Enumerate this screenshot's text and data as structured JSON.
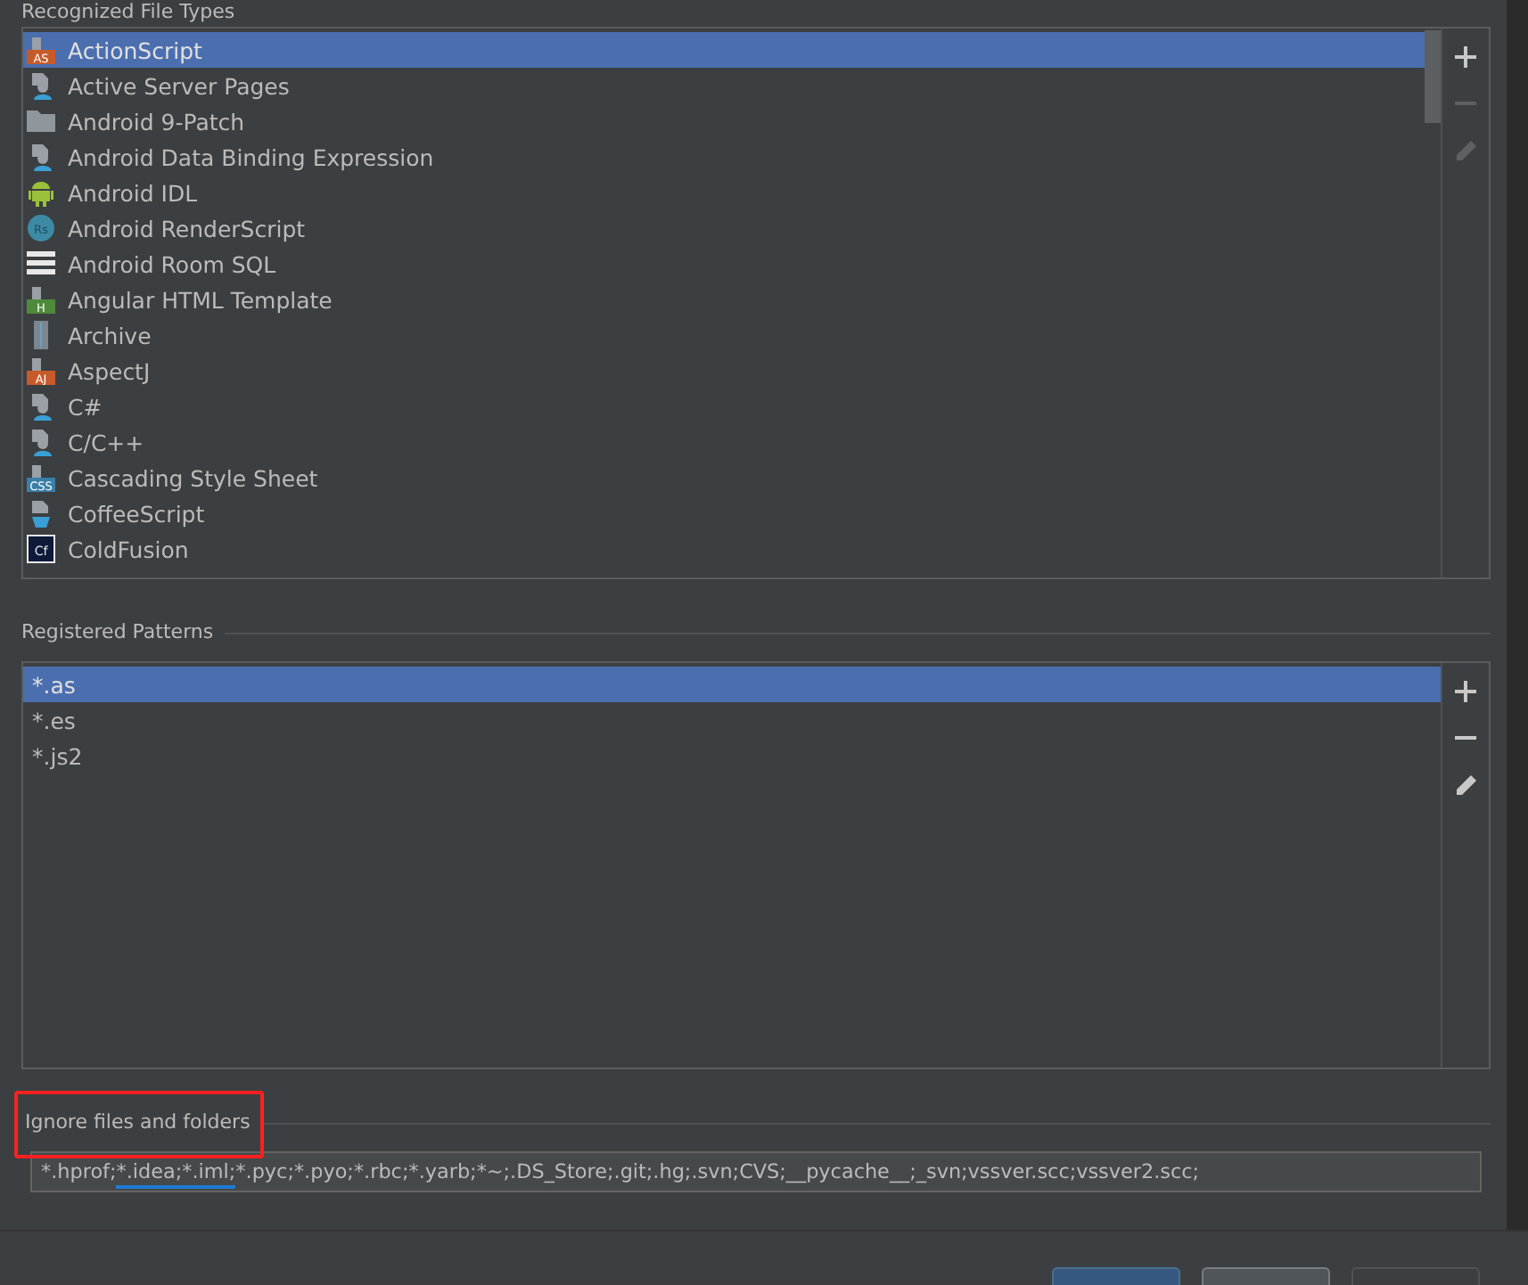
{
  "file_types": {
    "title": "Recognized File Types",
    "items": [
      {
        "label": "ActionScript",
        "kind": "badge",
        "badge": "AS",
        "color": "#c75a2a",
        "selected": true
      },
      {
        "label": "Active Server Pages",
        "kind": "person",
        "selected": false
      },
      {
        "label": "Android 9-Patch",
        "kind": "folder",
        "selected": false
      },
      {
        "label": "Android Data Binding Expression",
        "kind": "person",
        "selected": false
      },
      {
        "label": "Android IDL",
        "kind": "android",
        "selected": false
      },
      {
        "label": "Android RenderScript",
        "kind": "round",
        "badge": "Rs",
        "color": "#3d8aa5",
        "selected": false
      },
      {
        "label": "Android Room SQL",
        "kind": "lines",
        "selected": false
      },
      {
        "label": "Angular HTML Template",
        "kind": "badge",
        "badge": "H",
        "color": "#4e8a3a",
        "selected": false
      },
      {
        "label": "Archive",
        "kind": "archive",
        "selected": false
      },
      {
        "label": "AspectJ",
        "kind": "badge",
        "badge": "AJ",
        "color": "#c75a2a",
        "selected": false
      },
      {
        "label": "C#",
        "kind": "person",
        "selected": false
      },
      {
        "label": "C/C++",
        "kind": "person",
        "selected": false
      },
      {
        "label": "Cascading Style Sheet",
        "kind": "badge",
        "badge": "CSS",
        "color": "#3a7fa8",
        "selected": false
      },
      {
        "label": "CoffeeScript",
        "kind": "cup",
        "selected": false
      },
      {
        "label": "ColdFusion",
        "kind": "square",
        "badge": "Cf",
        "selected": false
      }
    ],
    "toolbar": [
      {
        "kind": "add",
        "disabled": false
      },
      {
        "kind": "remove",
        "disabled": true
      },
      {
        "kind": "edit",
        "disabled": true
      }
    ]
  },
  "patterns": {
    "title": "Registered Patterns",
    "items": [
      {
        "label": "*.as",
        "selected": true
      },
      {
        "label": "*.es",
        "selected": false
      },
      {
        "label": "*.js2",
        "selected": false
      }
    ],
    "toolbar": [
      {
        "kind": "add",
        "disabled": false
      },
      {
        "kind": "remove",
        "disabled": false
      },
      {
        "kind": "edit",
        "disabled": false
      }
    ]
  },
  "ignore": {
    "title": "Ignore files and folders",
    "highlighted": true,
    "value_parts": [
      {
        "text": "*.hprof;",
        "underlined": false
      },
      {
        "text": "*.idea;",
        "underlined": true
      },
      {
        "text": "*.iml;",
        "underlined": true
      },
      {
        "text": "*.pyc;*.pyo;*.rbc;*.yarb;*~;.DS_Store;.git;.hg;.svn;CVS;__pycache__;_svn;vssver.scc;vssver2.scc;",
        "underlined": false
      }
    ]
  },
  "buttons": [
    {
      "kind": "default",
      "disabled": false
    },
    {
      "kind": "normal",
      "disabled": false
    },
    {
      "kind": "normal",
      "disabled": true
    }
  ]
}
